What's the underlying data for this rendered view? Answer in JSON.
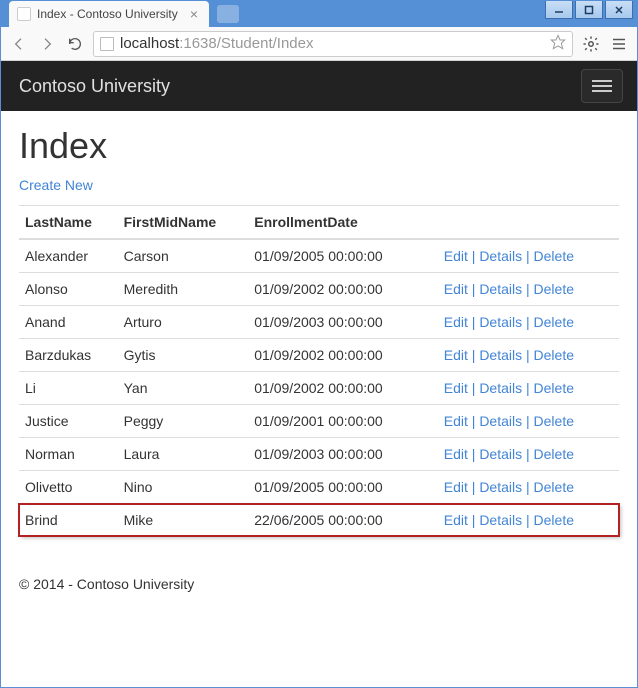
{
  "window": {
    "tab_title": "Index - Contoso University"
  },
  "address_bar": {
    "host": "localhost",
    "port_path": ":1638/Student/Index"
  },
  "navbar": {
    "brand": "Contoso University"
  },
  "page": {
    "heading": "Index",
    "create_new_label": "Create New",
    "footer": "© 2014 - Contoso University"
  },
  "table": {
    "headers": {
      "last_name": "LastName",
      "first_mid_name": "FirstMidName",
      "enrollment_date": "EnrollmentDate"
    },
    "action_labels": {
      "edit": "Edit",
      "details": "Details",
      "delete": "Delete",
      "separator": " | "
    },
    "rows": [
      {
        "last_name": "Alexander",
        "first_mid_name": "Carson",
        "enrollment_date": "01/09/2005 00:00:00",
        "highlight": false
      },
      {
        "last_name": "Alonso",
        "first_mid_name": "Meredith",
        "enrollment_date": "01/09/2002 00:00:00",
        "highlight": false
      },
      {
        "last_name": "Anand",
        "first_mid_name": "Arturo",
        "enrollment_date": "01/09/2003 00:00:00",
        "highlight": false
      },
      {
        "last_name": "Barzdukas",
        "first_mid_name": "Gytis",
        "enrollment_date": "01/09/2002 00:00:00",
        "highlight": false
      },
      {
        "last_name": "Li",
        "first_mid_name": "Yan",
        "enrollment_date": "01/09/2002 00:00:00",
        "highlight": false
      },
      {
        "last_name": "Justice",
        "first_mid_name": "Peggy",
        "enrollment_date": "01/09/2001 00:00:00",
        "highlight": false
      },
      {
        "last_name": "Norman",
        "first_mid_name": "Laura",
        "enrollment_date": "01/09/2003 00:00:00",
        "highlight": false
      },
      {
        "last_name": "Olivetto",
        "first_mid_name": "Nino",
        "enrollment_date": "01/09/2005 00:00:00",
        "highlight": false
      },
      {
        "last_name": "Brind",
        "first_mid_name": "Mike",
        "enrollment_date": "22/06/2005 00:00:00",
        "highlight": true
      }
    ]
  }
}
